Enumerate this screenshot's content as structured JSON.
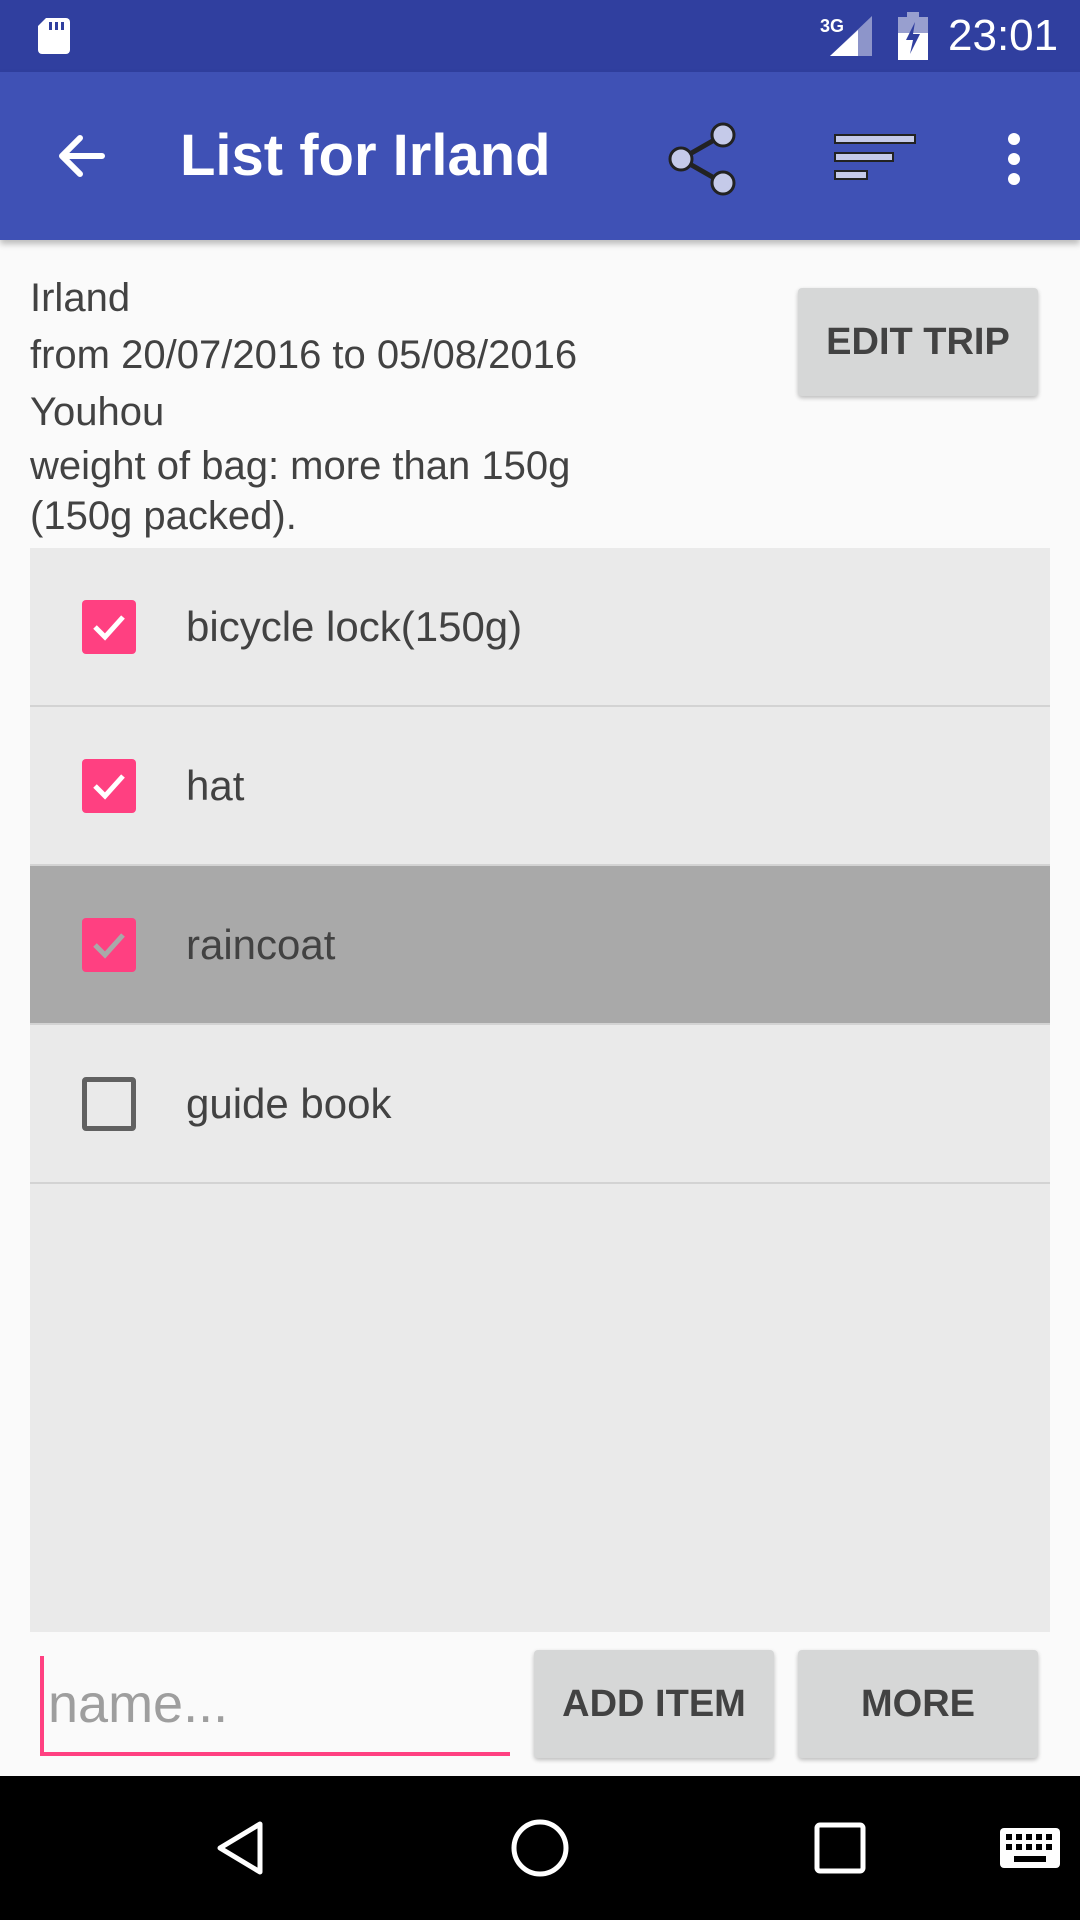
{
  "status_bar": {
    "time": "23:01",
    "network": "3G",
    "icons": [
      "sd-card-icon",
      "signal-3g-icon",
      "battery-charging-icon"
    ]
  },
  "app_bar": {
    "title": "List for Irland",
    "actions": [
      "back-arrow-icon",
      "share-icon",
      "sort-icon",
      "overflow-menu-icon"
    ]
  },
  "trip": {
    "name": "Irland",
    "dates": "from 20/07/2016 to 05/08/2016",
    "note": "Youhou",
    "weight": "weight of bag: more than 150g (150g packed).",
    "edit_label": "EDIT TRIP"
  },
  "items": [
    {
      "label": "bicycle lock(150g)",
      "checked": true,
      "highlighted": false
    },
    {
      "label": "hat",
      "checked": true,
      "highlighted": false
    },
    {
      "label": "raincoat",
      "checked": true,
      "highlighted": true
    },
    {
      "label": "guide book",
      "checked": false,
      "highlighted": false
    }
  ],
  "bottom": {
    "name_placeholder": "name...",
    "name_value": "",
    "add_item_label": "ADD ITEM",
    "more_label": "MORE"
  },
  "nav_bar": {
    "icons": [
      "nav-back-icon",
      "nav-home-icon",
      "nav-recents-icon",
      "keyboard-icon"
    ]
  },
  "colors": {
    "status_bar": "#303f9f",
    "app_bar": "#3f51b5",
    "accent": "#ff4081",
    "button": "#d6d7d7",
    "list_bg": "#eaeaea",
    "highlight_row": "#a9a9a9"
  }
}
